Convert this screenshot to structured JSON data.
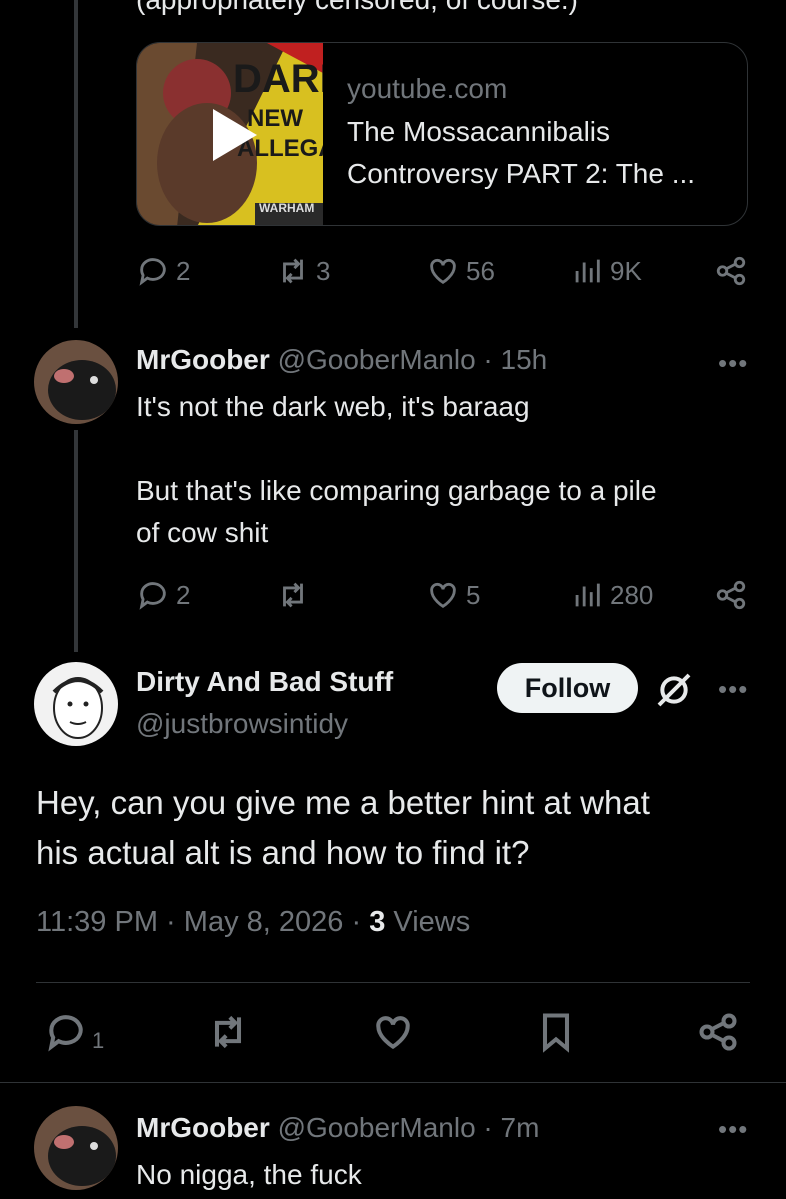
{
  "top_cut_text": "(appropriately censored, of course.)",
  "card": {
    "thumb_text_1": "DARK",
    "thumb_text_2": "NEW",
    "thumb_text_3": "ALLEGAT",
    "thumb_text_4": "WARHAM",
    "domain": "youtube.com",
    "title_line1": "The Mossacannibalis",
    "title_line2": "Controversy PART 2: The ..."
  },
  "tweet1_actions": {
    "replies": "2",
    "reposts": "3",
    "likes": "56",
    "views": "9K"
  },
  "reply1": {
    "name": "MrGoober",
    "handle": "@GooberManlo",
    "time": "15h",
    "line1": "It's not the dark web, it's baraag",
    "line2": "But that's like comparing garbage to a pile",
    "line3": "of cow shit",
    "actions": {
      "replies": "2",
      "reposts": "",
      "likes": "5",
      "views": "280"
    }
  },
  "main_tweet": {
    "name": "Dirty And Bad Stuff",
    "handle": "@justbrowsintidy",
    "follow_label": "Follow",
    "text_line1": "Hey, can you give me a better hint at what",
    "text_line2": "his actual alt is and how to find it?",
    "time": "11:39 PM",
    "date": "May 8, 2026",
    "views_count": "3",
    "views_label": "Views",
    "reply_count": "1"
  },
  "reply2": {
    "name": "MrGoober",
    "handle": "@GooberManlo",
    "time": "7m",
    "text": "No nigga, the fuck"
  },
  "more_label": "•••",
  "separator": "·",
  "icons": [
    "reply-icon",
    "repost-icon",
    "like-icon",
    "views-icon",
    "share-icon",
    "more-icon",
    "bookmark-icon",
    "grok-icon",
    "play-icon"
  ]
}
